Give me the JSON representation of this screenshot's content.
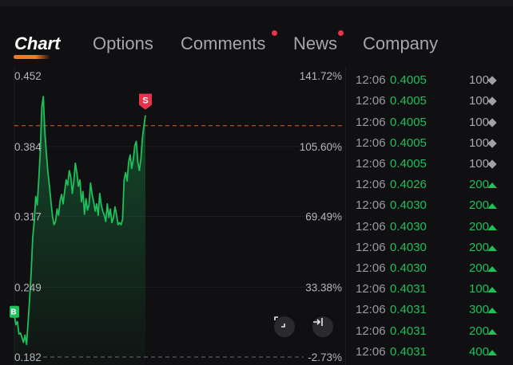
{
  "tabs": [
    {
      "label": "Chart",
      "active": true,
      "notification": false
    },
    {
      "label": "Options",
      "active": false,
      "notification": false
    },
    {
      "label": "Comments",
      "active": false,
      "notification": true
    },
    {
      "label": "News",
      "active": false,
      "notification": true
    },
    {
      "label": "Company",
      "active": false,
      "notification": false
    }
  ],
  "chart": {
    "price_labels": [
      "0.452",
      "0.384",
      "0.317",
      "0.249",
      "0.182"
    ],
    "percent_labels": [
      "141.72%",
      "105.60%",
      "69.49%",
      "33.38%",
      "-2.73%"
    ],
    "reference_line_price": 0.404,
    "buy_marker": "B",
    "sell_marker": "S",
    "fullscreen_icon": "expand-icon",
    "jump_icon": "jump-to-end-icon",
    "colors": {
      "line": "#1fbf5b",
      "reference": "#e0602a",
      "sell": "#e8334a",
      "buy": "#1fbf5b"
    }
  },
  "chart_data": {
    "type": "area",
    "ylim": [
      0.182,
      0.452
    ],
    "yticks": [
      0.452,
      0.384,
      0.317,
      0.249,
      0.182
    ],
    "secondary_yticks": [
      "141.72%",
      "105.60%",
      "69.49%",
      "33.38%",
      "-2.73%"
    ],
    "values": [
      0.222,
      0.213,
      0.216,
      0.204,
      0.205,
      0.201,
      0.196,
      0.203,
      0.194,
      0.216,
      0.238,
      0.263,
      0.296,
      0.312,
      0.336,
      0.328,
      0.352,
      0.379,
      0.422,
      0.432,
      0.398,
      0.378,
      0.359,
      0.346,
      0.331,
      0.317,
      0.309,
      0.312,
      0.324,
      0.318,
      0.332,
      0.338,
      0.329,
      0.341,
      0.352,
      0.347,
      0.361,
      0.355,
      0.339,
      0.351,
      0.368,
      0.359,
      0.346,
      0.352,
      0.331,
      0.341,
      0.319,
      0.334,
      0.323,
      0.328,
      0.349,
      0.338,
      0.331,
      0.322,
      0.329,
      0.318,
      0.339,
      0.328,
      0.322,
      0.318,
      0.312,
      0.329,
      0.316,
      0.324,
      0.311,
      0.316,
      0.326,
      0.319,
      0.309,
      0.311,
      0.309,
      0.314,
      0.352,
      0.359,
      0.351,
      0.369,
      0.376,
      0.363,
      0.371,
      0.385,
      0.389,
      0.369,
      0.361,
      0.372,
      0.392,
      0.404,
      0.414
    ],
    "reference_value": 0.404
  },
  "trades": [
    {
      "time": "12:06",
      "price": "0.4005",
      "volume": "100",
      "side": "neutral"
    },
    {
      "time": "12:06",
      "price": "0.4005",
      "volume": "100",
      "side": "neutral"
    },
    {
      "time": "12:06",
      "price": "0.4005",
      "volume": "100",
      "side": "neutral"
    },
    {
      "time": "12:06",
      "price": "0.4005",
      "volume": "100",
      "side": "neutral"
    },
    {
      "time": "12:06",
      "price": "0.4005",
      "volume": "100",
      "side": "neutral"
    },
    {
      "time": "12:06",
      "price": "0.4026",
      "volume": "200",
      "side": "up"
    },
    {
      "time": "12:06",
      "price": "0.4030",
      "volume": "200",
      "side": "up"
    },
    {
      "time": "12:06",
      "price": "0.4030",
      "volume": "200",
      "side": "up"
    },
    {
      "time": "12:06",
      "price": "0.4030",
      "volume": "200",
      "side": "up"
    },
    {
      "time": "12:06",
      "price": "0.4030",
      "volume": "200",
      "side": "up"
    },
    {
      "time": "12:06",
      "price": "0.4031",
      "volume": "100",
      "side": "up"
    },
    {
      "time": "12:06",
      "price": "0.4031",
      "volume": "300",
      "side": "up"
    },
    {
      "time": "12:06",
      "price": "0.4031",
      "volume": "200",
      "side": "up"
    },
    {
      "time": "12:06",
      "price": "0.4031",
      "volume": "400",
      "side": "up"
    }
  ]
}
